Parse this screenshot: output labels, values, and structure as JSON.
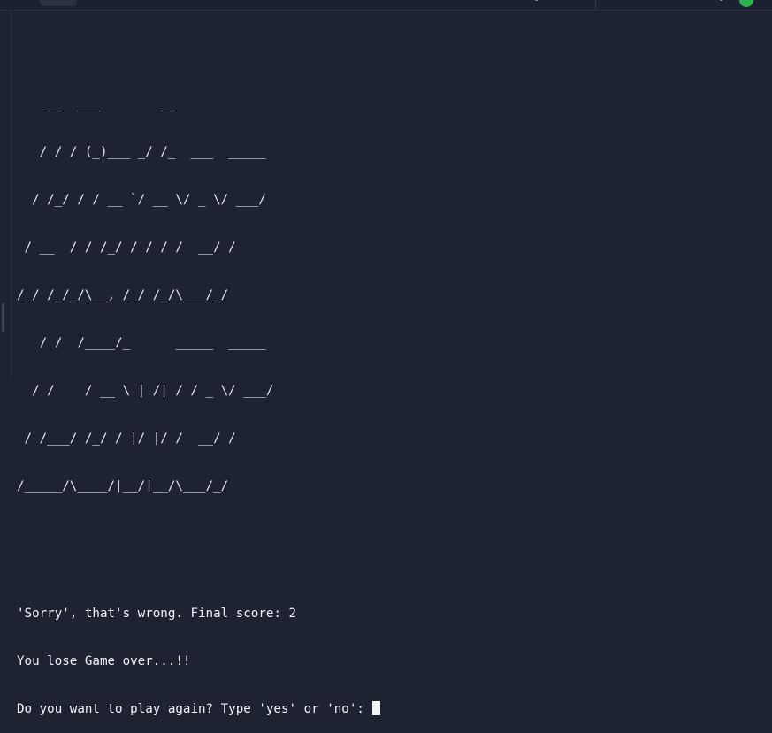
{
  "banner": {
    "art_lines": [
      "    __  ___        __",
      "   / / / (_)___ _/ /_  ___  _____",
      "  / /_/ / / __ `/ __ \\/ _ \\/ ___/",
      " / __  / / /_/ / / / /  __/ /",
      "/_/ /_/_/\\__, /_/ /_/\\___/_/",
      "   / /  /____/_      _____  _____",
      "  / /    / __ \\ | /| / / _ \\/ ___/",
      " / /___/ /_/ / |/ |/ /  __/ /",
      "/_____/\\____/|__/|__/\\___/_/"
    ]
  },
  "output": {
    "result_line": "'Sorry', that's wrong. Final score: 2",
    "game_over_line": "You lose Game over...!!",
    "prompt_line": "Do you want to play again? Type 'yes' or 'no': "
  },
  "colors": {
    "background": "#1d2331",
    "text": "#eef1f6",
    "status_dot": "#2bb24c"
  }
}
